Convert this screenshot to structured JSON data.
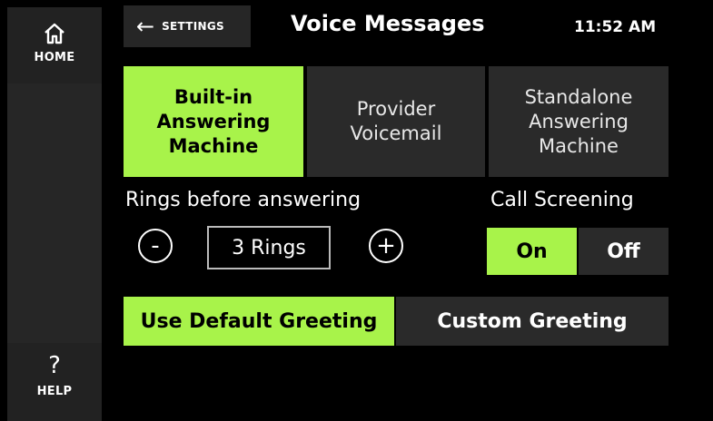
{
  "sidebar": {
    "home_label": "HOME",
    "home_icon": "home-icon",
    "help_glyph": "?",
    "help_label": "HELP"
  },
  "header": {
    "back_arrow": "←",
    "back_label": "SETTINGS",
    "title": "Voice Messages",
    "time": "11:52 AM"
  },
  "modes": [
    {
      "label": "Built-in Answering Machine",
      "selected": true
    },
    {
      "label": "Provider Voicemail",
      "selected": false
    },
    {
      "label": "Standalone Answering Machine",
      "selected": false
    }
  ],
  "rings": {
    "label": "Rings before answering",
    "decrement": "-",
    "value": "3 Rings",
    "increment": "+"
  },
  "call_screening": {
    "label": "Call Screening",
    "on_label": "On",
    "off_label": "Off",
    "selected": "On"
  },
  "greetings": [
    {
      "label": "Use Default Greeting",
      "selected": true
    },
    {
      "label": "Custom Greeting",
      "selected": false
    }
  ],
  "colors": {
    "accent": "#a8f34a",
    "button_bg": "#2a2a2a",
    "background": "#000000"
  }
}
